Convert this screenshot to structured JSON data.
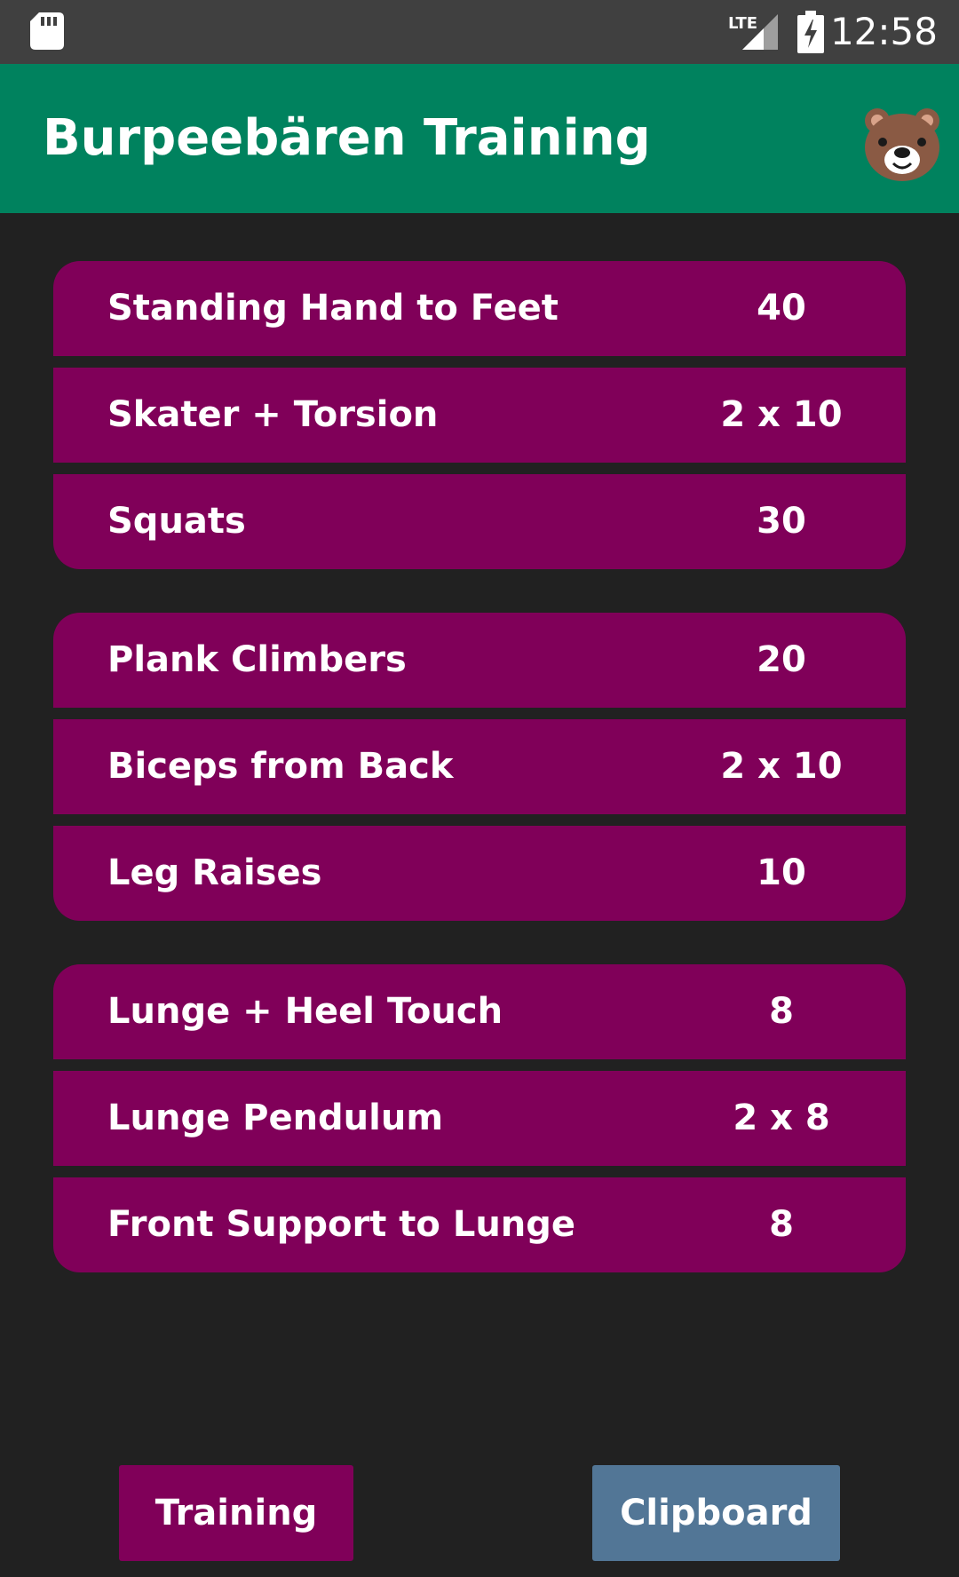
{
  "status_bar": {
    "time": "12:58",
    "icons": [
      "sd-card-icon",
      "lte-signal-icon",
      "battery-charging-icon"
    ]
  },
  "app_bar": {
    "title": "Burpeebären Training",
    "icon": "bear-face-icon"
  },
  "colors": {
    "app_bar": "#00825e",
    "card": "#800059",
    "background": "#212121",
    "clipboard_button": "#527696",
    "status_bar": "#404040"
  },
  "groups": [
    {
      "exercises": [
        {
          "name": "Standing Hand to Feet",
          "reps": "40"
        },
        {
          "name": "Skater + Torsion",
          "reps": "2 x 10"
        },
        {
          "name": "Squats",
          "reps": "30"
        }
      ]
    },
    {
      "exercises": [
        {
          "name": "Plank Climbers",
          "reps": "20"
        },
        {
          "name": "Biceps from Back",
          "reps": "2 x 10"
        },
        {
          "name": "Leg Raises",
          "reps": "10"
        }
      ]
    },
    {
      "exercises": [
        {
          "name": "Lunge + Heel Touch",
          "reps": "8"
        },
        {
          "name": "Lunge Pendulum",
          "reps": "2 x 8"
        },
        {
          "name": "Front Support to Lunge",
          "reps": "8"
        }
      ]
    }
  ],
  "buttons": {
    "training": "Training",
    "clipboard": "Clipboard"
  }
}
